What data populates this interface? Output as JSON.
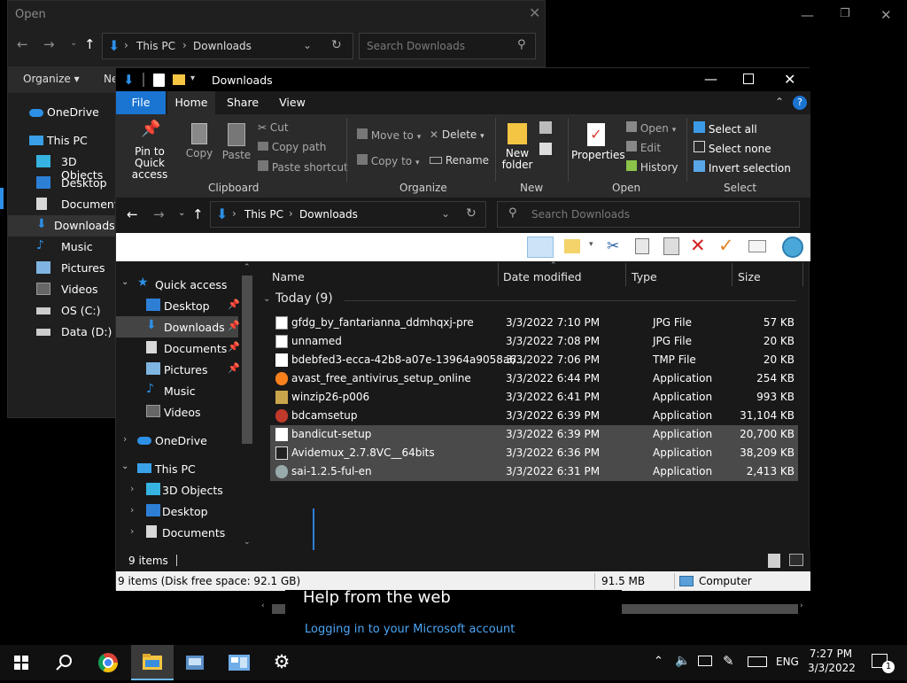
{
  "dialog": {
    "title": "Open",
    "breadcrumb": [
      "This PC",
      "Downloads"
    ],
    "search_placeholder": "Search Downloads",
    "organize": "Organize ▾",
    "new_label": "Ne",
    "sidebar": [
      "OneDrive",
      "This PC",
      "3D Objects",
      "Desktop",
      "Documents",
      "Downloads",
      "Music",
      "Pictures",
      "Videos",
      "OS (C:)",
      "Data (D:)"
    ]
  },
  "explorer": {
    "title": "Downloads",
    "ribbon_tabs": [
      "File",
      "Home",
      "Share",
      "View"
    ],
    "clipboard": {
      "pin": "Pin to Quick access",
      "copy": "Copy",
      "paste": "Paste",
      "cut": "Cut",
      "copy_path": "Copy path",
      "paste_shortcut": "Paste shortcut",
      "group": "Clipboard"
    },
    "organize": {
      "move_to": "Move to",
      "copy_to": "Copy to",
      "delete": "Delete",
      "rename": "Rename",
      "group": "Organize"
    },
    "new": {
      "new_folder": "New folder",
      "group": "New"
    },
    "open": {
      "properties": "Properties",
      "open": "Open",
      "edit": "Edit",
      "history": "History",
      "group": "Open"
    },
    "select": {
      "select_all": "Select all",
      "select_none": "Select none",
      "invert": "Invert selection",
      "group": "Select"
    },
    "breadcrumb": [
      "This PC",
      "Downloads"
    ],
    "search_placeholder": "Search Downloads",
    "nav": {
      "quick_access": "Quick access",
      "quick_items": [
        "Desktop",
        "Downloads",
        "Documents",
        "Pictures",
        "Music",
        "Videos"
      ],
      "onedrive": "OneDrive",
      "this_pc": "This PC",
      "pc_items": [
        "3D Objects",
        "Desktop",
        "Documents"
      ]
    },
    "columns": [
      "Name",
      "Date modified",
      "Type",
      "Size"
    ],
    "group_label": "Today (9)",
    "files": [
      {
        "name": "gfdg_by_fantarianna_ddmhqxj-pre",
        "date": "3/3/2022 7:10 PM",
        "type": "JPG File",
        "size": "57 KB",
        "icon": "image-file-icon",
        "selected": false
      },
      {
        "name": "unnamed",
        "date": "3/3/2022 7:08 PM",
        "type": "JPG File",
        "size": "20 KB",
        "icon": "image-file-icon",
        "selected": false
      },
      {
        "name": "bdebfed3-ecca-42b8-a07e-13964a9058a6...",
        "date": "3/3/2022 7:06 PM",
        "type": "TMP File",
        "size": "20 KB",
        "icon": "blank-file-icon",
        "selected": false
      },
      {
        "name": "avast_free_antivirus_setup_online",
        "date": "3/3/2022 6:44 PM",
        "type": "Application",
        "size": "254 KB",
        "icon": "avast-icon",
        "selected": false
      },
      {
        "name": "winzip26-p006",
        "date": "3/3/2022 6:41 PM",
        "type": "Application",
        "size": "993 KB",
        "icon": "winzip-icon",
        "selected": false
      },
      {
        "name": "bdcamsetup",
        "date": "3/3/2022 6:39 PM",
        "type": "Application",
        "size": "31,104 KB",
        "icon": "bandicam-icon",
        "selected": false
      },
      {
        "name": "bandicut-setup",
        "date": "3/3/2022 6:39 PM",
        "type": "Application",
        "size": "20,700 KB",
        "icon": "blank-file-icon",
        "selected": true
      },
      {
        "name": "Avidemux_2.7.8VC__64bits",
        "date": "3/3/2022 6:36 PM",
        "type": "Application",
        "size": "38,209 KB",
        "icon": "avidemux-icon",
        "selected": true
      },
      {
        "name": "sai-1.2.5-ful-en",
        "date": "3/3/2022 6:31 PM",
        "type": "Application",
        "size": "2,413 KB",
        "icon": "sai-icon",
        "selected": true
      }
    ],
    "item_count": "9 items",
    "status_left": "9 items (Disk free space: 92.1 GB)",
    "status_size": "91.5 MB",
    "status_location": "Computer"
  },
  "help": {
    "title": "Help from the web",
    "link": "Logging in to your Microsoft account"
  },
  "taskbar": {
    "lang": "ENG",
    "time": "7:27 PM",
    "date": "3/3/2022",
    "notifications": "1"
  }
}
